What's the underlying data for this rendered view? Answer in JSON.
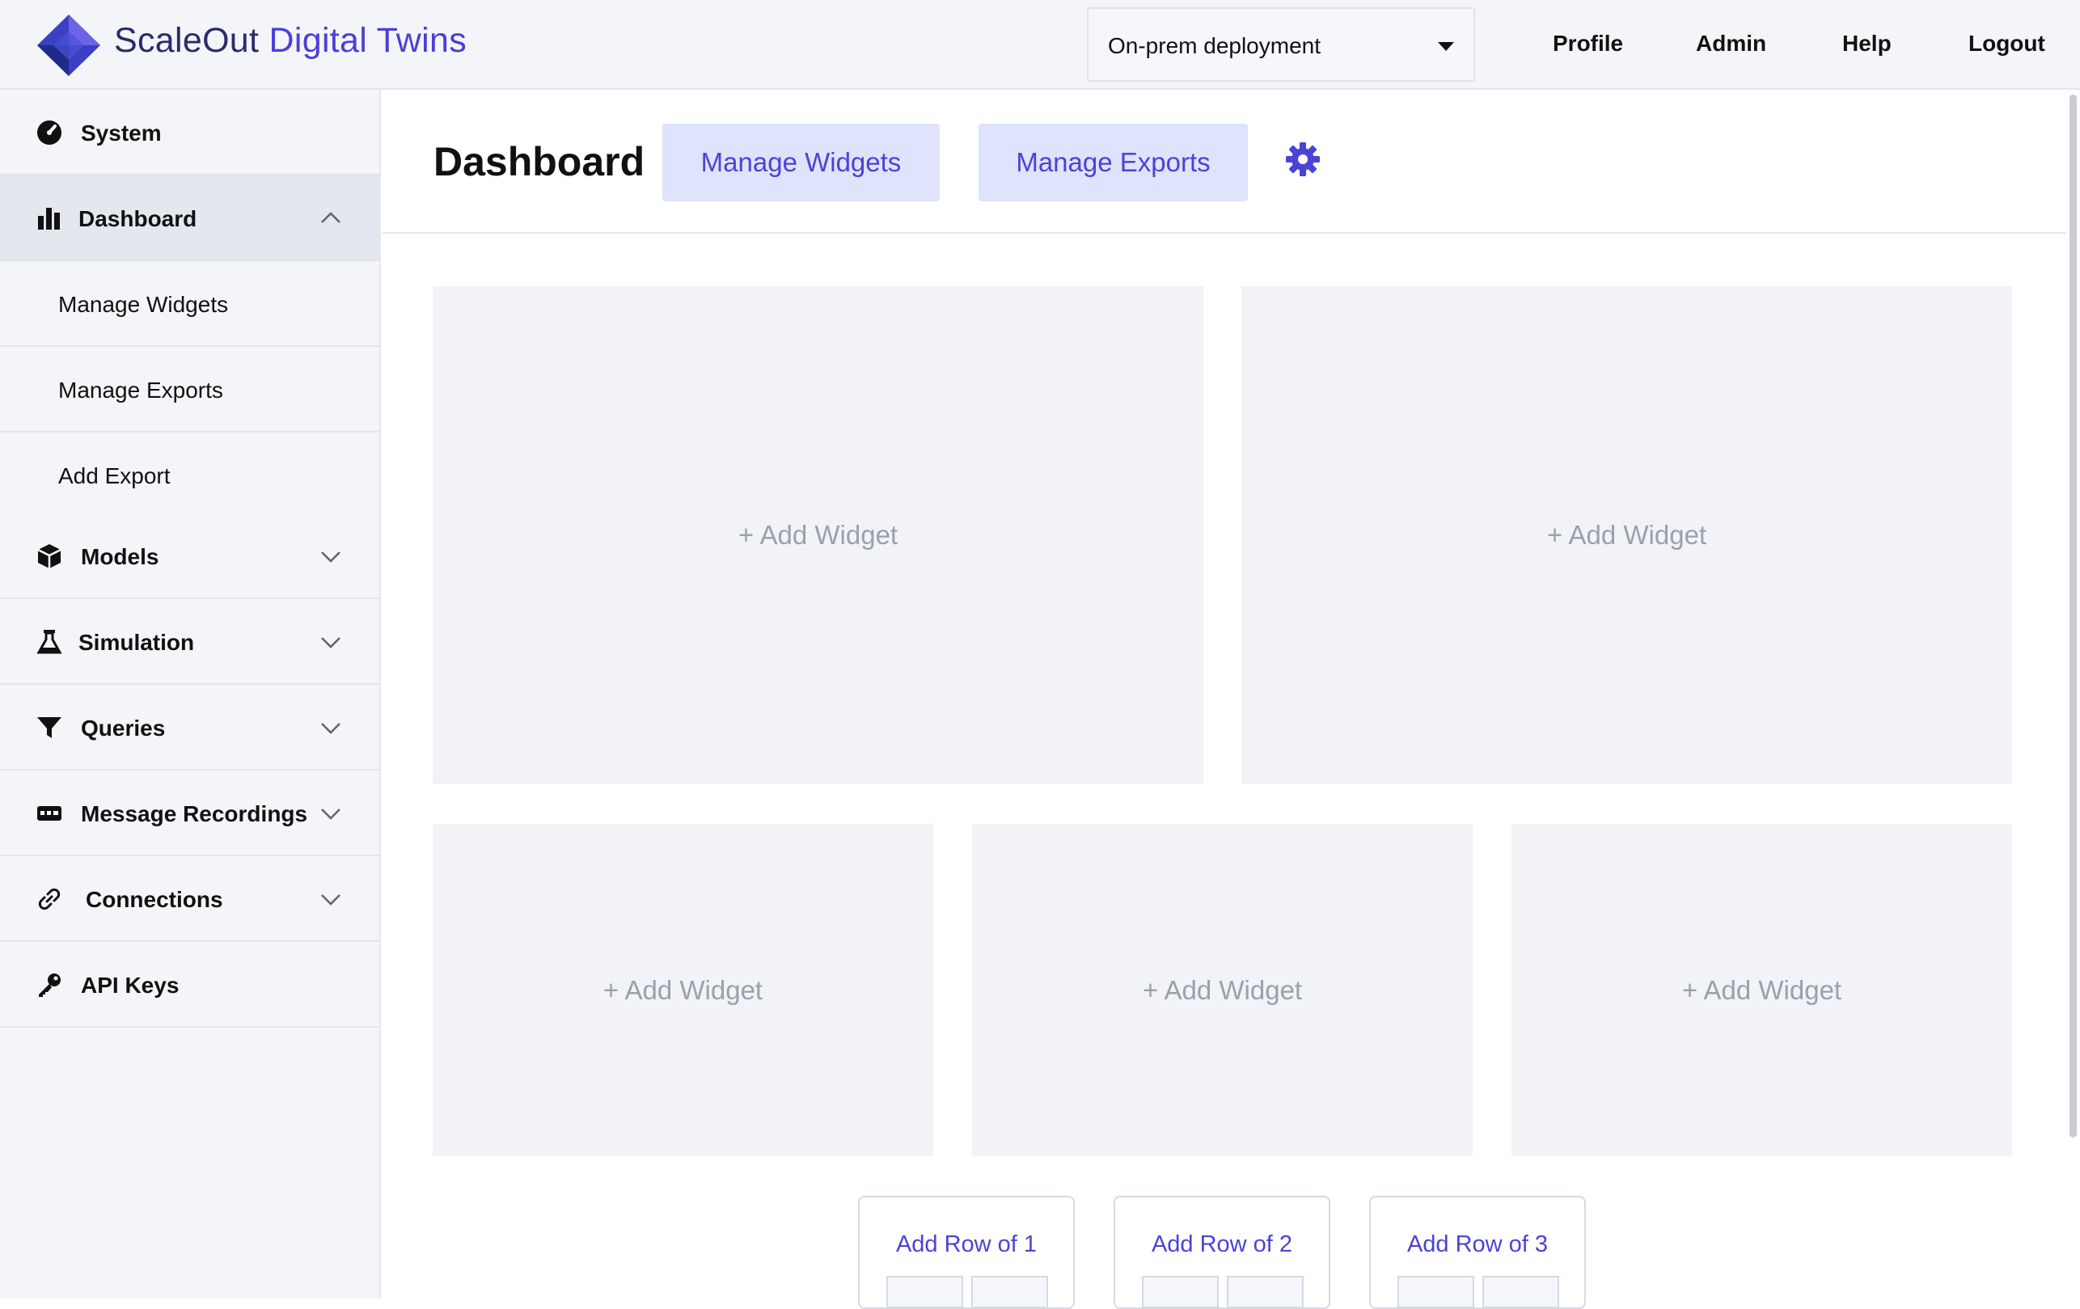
{
  "header": {
    "brand_part1": "ScaleOut",
    "brand_part2": "Digital Twins",
    "deployment": "On-prem deployment",
    "nav": [
      "Profile",
      "Admin",
      "Help",
      "Logout"
    ]
  },
  "sidebar": {
    "items": [
      {
        "label": "System",
        "icon": "system-icon"
      },
      {
        "label": "Dashboard",
        "icon": "bar-chart-icon",
        "expanded": true
      },
      {
        "label": "Models",
        "icon": "cube-icon"
      },
      {
        "label": "Simulation",
        "icon": "flask-icon"
      },
      {
        "label": "Queries",
        "icon": "filter-icon"
      },
      {
        "label": "Message Recordings",
        "icon": "recording-icon"
      },
      {
        "label": "Connections",
        "icon": "link-icon"
      },
      {
        "label": "API Keys",
        "icon": "key-icon"
      }
    ],
    "dashboard_sub": [
      "Manage Widgets",
      "Manage Exports",
      "Add Export"
    ]
  },
  "main": {
    "title": "Dashboard",
    "manage_widgets": "Manage Widgets",
    "manage_exports": "Manage Exports",
    "add_widget": "+ Add Widget",
    "add_row_buttons": [
      "Add Row of 1",
      "Add Row of 2",
      "Add Row of 3"
    ]
  },
  "colors": {
    "accent": "#4b43d6",
    "accent_bg": "#dfe3fb",
    "sidebar_bg": "#f3f5f8",
    "widget_bg": "#f1f3f7"
  }
}
